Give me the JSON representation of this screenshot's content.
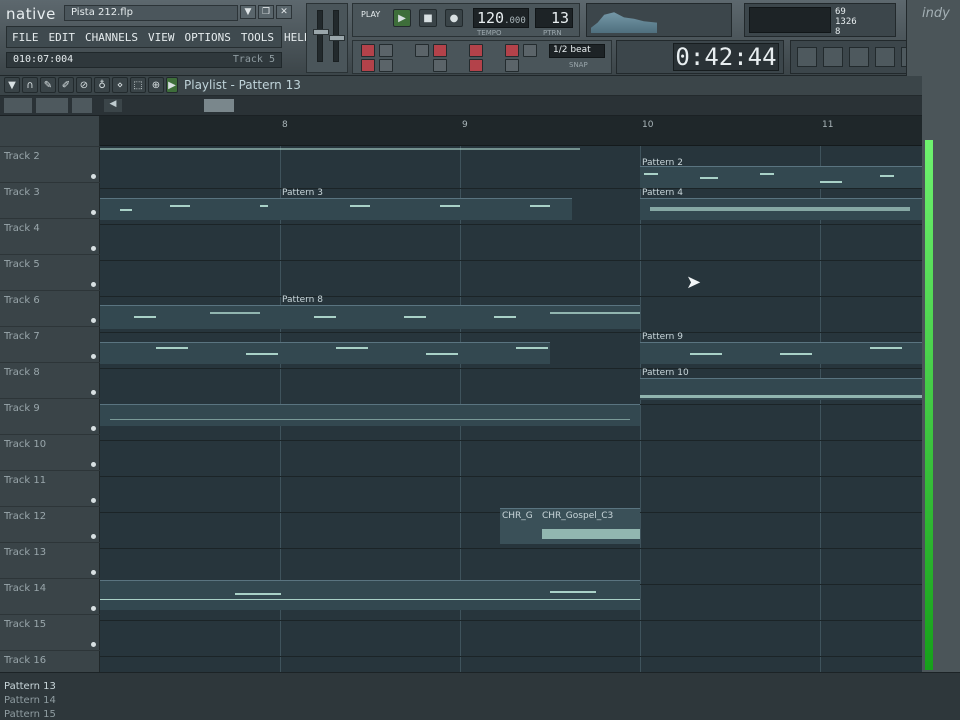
{
  "app": {
    "logo": "native",
    "file": "Pista 212.flp",
    "time_readout": "010:07:004",
    "hint_text": "Track 5"
  },
  "menu": [
    "FILE",
    "EDIT",
    "CHANNELS",
    "VIEW",
    "OPTIONS",
    "TOOLS",
    "HELP"
  ],
  "transport": {
    "play_mode": "PLAY",
    "tempo": "120",
    "tempo_dec": ".000",
    "tempo_label": "TEMPO",
    "pattern_num": "13",
    "pattern_label": "PTRN"
  },
  "snap": {
    "value": "1/2 beat",
    "label": "SNAP"
  },
  "clock": {
    "time": "0:42:44"
  },
  "cpu": {
    "cpu": "69",
    "ram": "1326",
    "poly": "8"
  },
  "playlist": {
    "title": "Playlist - Pattern 13"
  },
  "ruler": [
    {
      "label": "8"
    },
    {
      "label": "9"
    },
    {
      "label": "10"
    },
    {
      "label": "11"
    }
  ],
  "tracks": [
    "Track 2",
    "Track 3",
    "Track 4",
    "Track 5",
    "Track 6",
    "Track 7",
    "Track 8",
    "Track 9",
    "Track 10",
    "Track 11",
    "Track 12",
    "Track 13",
    "Track 14",
    "Track 15",
    "Track 16"
  ],
  "clips": [
    {
      "name": "Pattern 2"
    },
    {
      "name": "Pattern 3"
    },
    {
      "name": "Pattern 4"
    },
    {
      "name": "Pattern 8"
    },
    {
      "name": "Pattern 9"
    },
    {
      "name": "Pattern 10"
    },
    {
      "name": "CHR_G"
    },
    {
      "name": "CHR_Gospel_C3"
    }
  ],
  "patterns_list": [
    "Pattern 13",
    "Pattern 14",
    "Pattern 15"
  ],
  "indy_label": "indy"
}
